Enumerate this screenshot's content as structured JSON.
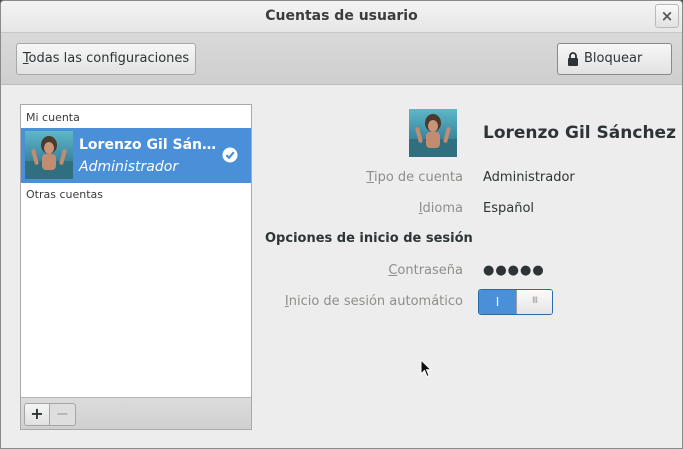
{
  "window": {
    "title": "Cuentas de usuario",
    "close_glyph": "×"
  },
  "toolbar": {
    "all_settings_accel": "T",
    "all_settings_rest": "odas las configuraciones",
    "lock_label": "Bloquear",
    "lock_icon": "lock-icon"
  },
  "accounts": {
    "my_account_label": "Mi cuenta",
    "other_accounts_label": "Otras cuentas",
    "current": {
      "name": "Lorenzo Gil Sán…",
      "role": "Administrador",
      "selected_icon": "check-icon"
    },
    "add_glyph": "+",
    "remove_glyph": "−"
  },
  "details": {
    "full_name": "Lorenzo Gil Sánchez",
    "account_type": {
      "accel": "T",
      "rest": "ipo de cuenta",
      "value": "Administrador"
    },
    "language": {
      "accel": "I",
      "rest": "dioma",
      "value": "Español"
    },
    "login_options_heading": "Opciones de inicio de sesión",
    "password": {
      "accel": "C",
      "rest": "ontraseña",
      "value": "●●●●●"
    },
    "auto_login": {
      "accel": "I",
      "rest": "nicio de sesión automático",
      "state_on_glyph": "I",
      "knob_glyph": "III",
      "enabled": true
    }
  },
  "colors": {
    "selection": "#4a90d9",
    "label_dim": "#8d8f8a"
  }
}
